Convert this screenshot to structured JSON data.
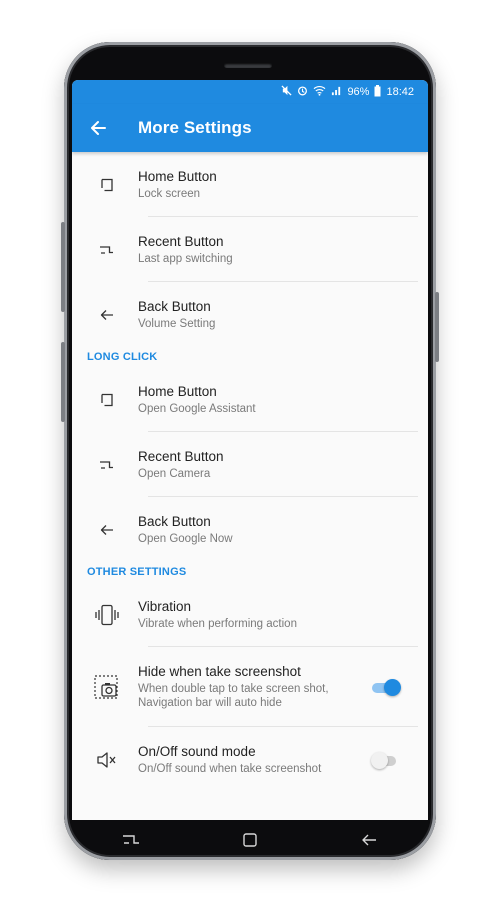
{
  "status_bar": {
    "battery": "96%",
    "time": "18:42"
  },
  "app_bar": {
    "title": "More Settings"
  },
  "rows_top": [
    {
      "title": "Home Button",
      "subtitle": "Lock screen",
      "icon": "home-square-icon"
    },
    {
      "title": "Recent Button",
      "subtitle": "Last app switching",
      "icon": "recent-icon"
    },
    {
      "title": "Back Button",
      "subtitle": "Volume Setting",
      "icon": "back-arrow-icon"
    }
  ],
  "section_long_click": "LONG CLICK",
  "rows_long": [
    {
      "title": "Home Button",
      "subtitle": "Open Google Assistant",
      "icon": "home-square-icon"
    },
    {
      "title": "Recent Button",
      "subtitle": "Open Camera",
      "icon": "recent-icon"
    },
    {
      "title": "Back Button",
      "subtitle": "Open Google Now",
      "icon": "back-arrow-icon"
    }
  ],
  "section_other": "OTHER SETTINGS",
  "rows_other": [
    {
      "title": "Vibration",
      "subtitle": "Vibrate when performing action",
      "icon": "vibration-icon"
    },
    {
      "title": "Hide when take screenshot",
      "subtitle": "When double tap to take screen shot, Navigation bar will auto hide",
      "icon": "screenshot-icon",
      "toggle": "on"
    },
    {
      "title": "On/Off sound mode",
      "subtitle": "On/Off sound when take screenshot",
      "icon": "mute-icon",
      "toggle": "off"
    }
  ],
  "colors": {
    "accent": "#1f8ae0"
  }
}
